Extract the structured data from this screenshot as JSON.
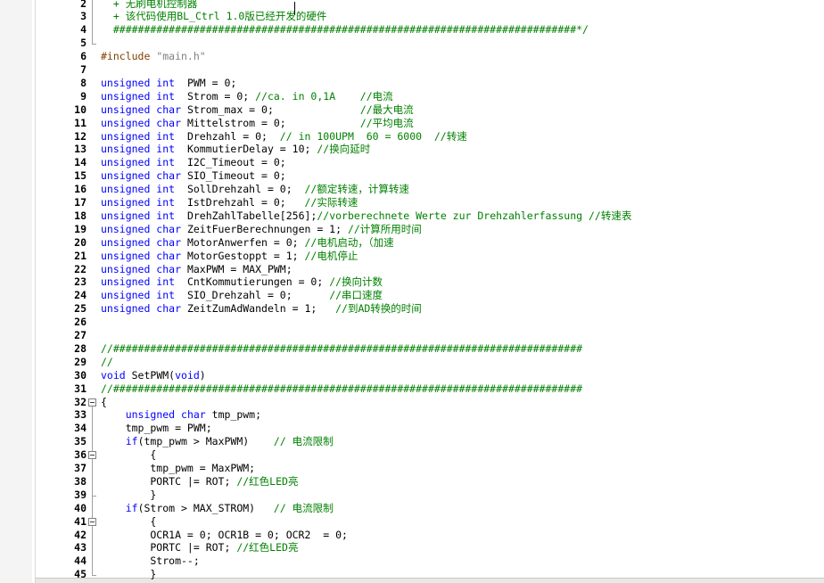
{
  "editor": {
    "line_numbers": [
      "2",
      "3",
      "4",
      "5",
      "6",
      "7",
      "8",
      "9",
      "10",
      "11",
      "12",
      "13",
      "14",
      "15",
      "16",
      "17",
      "18",
      "19",
      "20",
      "21",
      "22",
      "23",
      "24",
      "25",
      "26",
      "27",
      "28",
      "29",
      "30",
      "31",
      "32",
      "33",
      "34",
      "35",
      "36",
      "37",
      "38",
      "39",
      "40",
      "41",
      "42",
      "43",
      "44",
      "45"
    ],
    "lines": [
      [
        {
          "t": "  + 无刷电机控制器",
          "c": "comment"
        }
      ],
      [
        {
          "t": "  + 该代码使用BL_Ctrl 1.0版已经开发的硬件",
          "c": "comment"
        }
      ],
      [
        {
          "t": "  ###########################################################################*/",
          "c": "comment"
        }
      ],
      [
        {
          "t": "",
          "c": "plain"
        }
      ],
      [
        {
          "t": "#include ",
          "c": "preproc"
        },
        {
          "t": "\"main.h\"",
          "c": "string"
        }
      ],
      [
        {
          "t": "",
          "c": "plain"
        }
      ],
      [
        {
          "t": "unsigned int",
          "c": "keyword"
        },
        {
          "t": "  PWM = 0;",
          "c": "plain"
        }
      ],
      [
        {
          "t": "unsigned int",
          "c": "keyword"
        },
        {
          "t": "  Strom = 0; ",
          "c": "plain"
        },
        {
          "t": "//ca. in 0,1A    //电流",
          "c": "comment"
        }
      ],
      [
        {
          "t": "unsigned char",
          "c": "keyword"
        },
        {
          "t": " Strom_max = 0;              ",
          "c": "plain"
        },
        {
          "t": "//最大电流",
          "c": "comment"
        }
      ],
      [
        {
          "t": "unsigned char",
          "c": "keyword"
        },
        {
          "t": " Mittelstrom = 0;            ",
          "c": "plain"
        },
        {
          "t": "//平均电流",
          "c": "comment"
        }
      ],
      [
        {
          "t": "unsigned int",
          "c": "keyword"
        },
        {
          "t": "  Drehzahl = 0;  ",
          "c": "plain"
        },
        {
          "t": "// in 100UPM  60 = 6000  //转速",
          "c": "comment"
        }
      ],
      [
        {
          "t": "unsigned int",
          "c": "keyword"
        },
        {
          "t": "  KommutierDelay = 10; ",
          "c": "plain"
        },
        {
          "t": "//换向延时",
          "c": "comment"
        }
      ],
      [
        {
          "t": "unsigned int",
          "c": "keyword"
        },
        {
          "t": "  I2C_Timeout = 0;",
          "c": "plain"
        }
      ],
      [
        {
          "t": "unsigned char",
          "c": "keyword"
        },
        {
          "t": " SIO_Timeout = 0;",
          "c": "plain"
        }
      ],
      [
        {
          "t": "unsigned int",
          "c": "keyword"
        },
        {
          "t": "  SollDrehzahl = 0;  ",
          "c": "plain"
        },
        {
          "t": "//额定转速，计算转速",
          "c": "comment"
        }
      ],
      [
        {
          "t": "unsigned int",
          "c": "keyword"
        },
        {
          "t": "  IstDrehzahl = 0;   ",
          "c": "plain"
        },
        {
          "t": "//实际转速",
          "c": "comment"
        }
      ],
      [
        {
          "t": "unsigned int",
          "c": "keyword"
        },
        {
          "t": "  DrehZahlTabelle[256];",
          "c": "plain"
        },
        {
          "t": "//vorberechnete Werte zur Drehzahlerfassung //转速表",
          "c": "comment"
        }
      ],
      [
        {
          "t": "unsigned char",
          "c": "keyword"
        },
        {
          "t": " ZeitFuerBerechnungen = 1; ",
          "c": "plain"
        },
        {
          "t": "//计算所用时间",
          "c": "comment"
        }
      ],
      [
        {
          "t": "unsigned char",
          "c": "keyword"
        },
        {
          "t": " MotorAnwerfen = 0; ",
          "c": "plain"
        },
        {
          "t": "//电机启动，（加速",
          "c": "comment"
        }
      ],
      [
        {
          "t": "unsigned char",
          "c": "keyword"
        },
        {
          "t": " MotorGestoppt = 1; ",
          "c": "plain"
        },
        {
          "t": "//电机停止",
          "c": "comment"
        }
      ],
      [
        {
          "t": "unsigned char",
          "c": "keyword"
        },
        {
          "t": " MaxPWM = MAX_PWM;",
          "c": "plain"
        }
      ],
      [
        {
          "t": "unsigned int",
          "c": "keyword"
        },
        {
          "t": "  CntKommutierungen = 0; ",
          "c": "plain"
        },
        {
          "t": "//换向计数",
          "c": "comment"
        }
      ],
      [
        {
          "t": "unsigned int",
          "c": "keyword"
        },
        {
          "t": "  SIO_Drehzahl = 0;      ",
          "c": "plain"
        },
        {
          "t": "//串口速度",
          "c": "comment"
        }
      ],
      [
        {
          "t": "unsigned char",
          "c": "keyword"
        },
        {
          "t": " ZeitZumAdWandeln = 1;   ",
          "c": "plain"
        },
        {
          "t": "//到AD转换的时间",
          "c": "comment"
        }
      ],
      [
        {
          "t": "",
          "c": "plain"
        }
      ],
      [
        {
          "t": "",
          "c": "plain"
        }
      ],
      [
        {
          "t": "//############################################################################",
          "c": "comment"
        }
      ],
      [
        {
          "t": "//",
          "c": "comment"
        }
      ],
      [
        {
          "t": "void",
          "c": "keyword"
        },
        {
          "t": " SetPWM(",
          "c": "plain"
        },
        {
          "t": "void",
          "c": "keyword"
        },
        {
          "t": ")",
          "c": "plain"
        }
      ],
      [
        {
          "t": "//############################################################################",
          "c": "comment"
        }
      ],
      [
        {
          "t": "{",
          "c": "plain"
        }
      ],
      [
        {
          "t": "    ",
          "c": "plain"
        },
        {
          "t": "unsigned char",
          "c": "keyword"
        },
        {
          "t": " tmp_pwm;",
          "c": "plain"
        }
      ],
      [
        {
          "t": "    tmp_pwm = PWM;",
          "c": "plain"
        }
      ],
      [
        {
          "t": "    ",
          "c": "plain"
        },
        {
          "t": "if",
          "c": "keyword"
        },
        {
          "t": "(tmp_pwm > MaxPWM)    ",
          "c": "plain"
        },
        {
          "t": "// 电流限制",
          "c": "comment"
        }
      ],
      [
        {
          "t": "        {",
          "c": "plain"
        }
      ],
      [
        {
          "t": "        tmp_pwm = MaxPWM;",
          "c": "plain"
        }
      ],
      [
        {
          "t": "        PORTC |= ROT; ",
          "c": "plain"
        },
        {
          "t": "//红色LED亮",
          "c": "comment"
        }
      ],
      [
        {
          "t": "        }",
          "c": "plain"
        }
      ],
      [
        {
          "t": "    ",
          "c": "plain"
        },
        {
          "t": "if",
          "c": "keyword"
        },
        {
          "t": "(Strom > MAX_STROM)   ",
          "c": "plain"
        },
        {
          "t": "// 电流限制",
          "c": "comment"
        }
      ],
      [
        {
          "t": "        {",
          "c": "plain"
        }
      ],
      [
        {
          "t": "        OCR1A = 0; OCR1B = 0; OCR2  = 0;",
          "c": "plain"
        }
      ],
      [
        {
          "t": "        PORTC |= ROT; ",
          "c": "plain"
        },
        {
          "t": "//红色LED亮",
          "c": "comment"
        }
      ],
      [
        {
          "t": "        Strom--;",
          "c": "plain"
        }
      ],
      [
        {
          "t": "        }",
          "c": "plain"
        }
      ]
    ],
    "colors": {
      "keyword": "#0000ff",
      "comment": "#008000",
      "string": "#808080",
      "preproc": "#804000",
      "plain": "#000000",
      "line_number": "#000000"
    }
  }
}
